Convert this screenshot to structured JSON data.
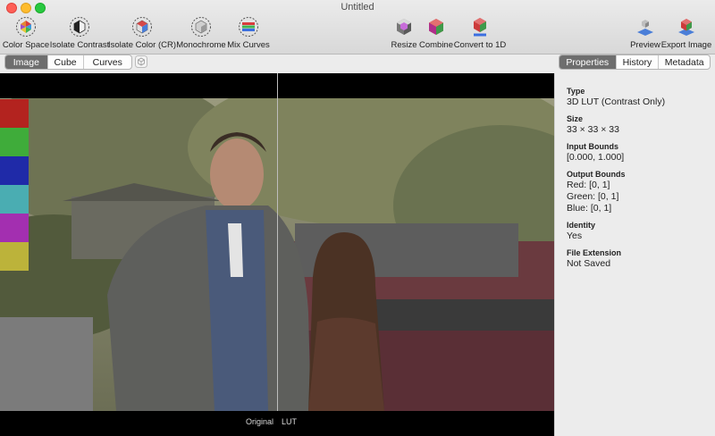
{
  "window": {
    "title": "Untitled"
  },
  "toolbar": {
    "left": [
      {
        "label": "Color Space"
      },
      {
        "label": "Isolate Contrast"
      },
      {
        "label": "Isolate Color (CR)"
      },
      {
        "label": "Monochrome"
      },
      {
        "label": "Mix Curves"
      }
    ],
    "center": [
      {
        "label": "Resize"
      },
      {
        "label": "Combine"
      },
      {
        "label": "Convert to 1D"
      }
    ],
    "right": [
      {
        "label": "Preview"
      },
      {
        "label": "Export Image"
      }
    ]
  },
  "view_tabs": {
    "selected": "Image",
    "items": [
      "Image",
      "Cube",
      "Curves"
    ]
  },
  "inspector_tabs": {
    "selected": "Properties",
    "items": [
      "Properties",
      "History",
      "Metadata"
    ]
  },
  "viewer": {
    "left_caption": "Original",
    "right_caption": "LUT",
    "swatch_colors": [
      "#b3231f",
      "#3fac3a",
      "#1f2aa8",
      "#4aadb2",
      "#a32fb0",
      "#bcb33a"
    ]
  },
  "properties": {
    "type_label": "Type",
    "type_value": "3D LUT (Contrast Only)",
    "size_label": "Size",
    "size_value": "33 × 33 × 33",
    "input_bounds_label": "Input Bounds",
    "input_bounds_value": "[0.000, 1.000]",
    "output_bounds_label": "Output Bounds",
    "output_red": "Red: [0, 1]",
    "output_green": "Green: [0, 1]",
    "output_blue": "Blue: [0, 1]",
    "identity_label": "Identity",
    "identity_value": "Yes",
    "file_ext_label": "File Extension",
    "file_ext_value": "Not Saved"
  }
}
